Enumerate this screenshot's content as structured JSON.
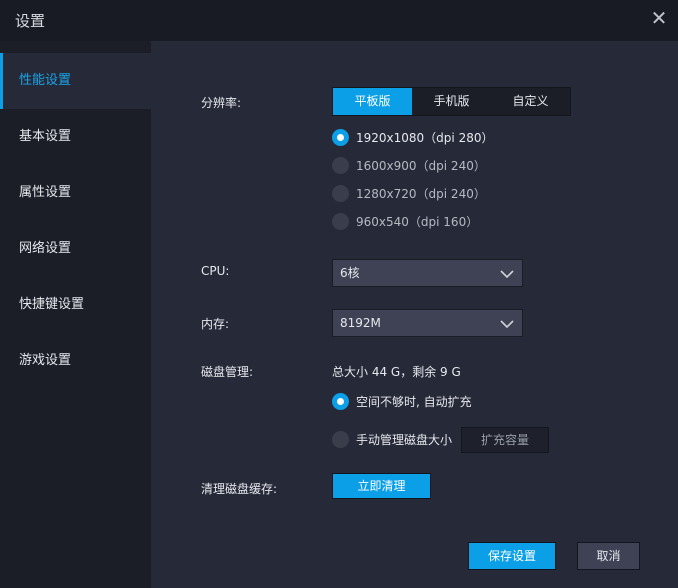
{
  "window": {
    "title": "设置"
  },
  "sidebar": {
    "items": [
      {
        "label": "性能设置",
        "active": true
      },
      {
        "label": "基本设置"
      },
      {
        "label": "属性设置"
      },
      {
        "label": "网络设置"
      },
      {
        "label": "快捷键设置"
      },
      {
        "label": "游戏设置"
      }
    ]
  },
  "resolution": {
    "label": "分辨率:",
    "tabs": [
      "平板版",
      "手机版",
      "自定义"
    ],
    "selected_tab": "平板版",
    "options": [
      "1920x1080（dpi 280）",
      "1600x900（dpi 240）",
      "1280x720（dpi 240）",
      "960x540（dpi 160）"
    ],
    "selected": "1920x1080（dpi 280）"
  },
  "cpu": {
    "label": "CPU:",
    "value": "6核"
  },
  "memory": {
    "label": "内存:",
    "value": "8192M"
  },
  "disk": {
    "label": "磁盘管理:",
    "summary": "总大小 44 G，剩余 9 G",
    "options": [
      "空间不够时, 自动扩充",
      "手动管理磁盘大小"
    ],
    "selected": "空间不够时, 自动扩充",
    "expand_label": "扩充容量"
  },
  "cache": {
    "label": "清理磁盘缓存:",
    "clear_label": "立即清理"
  },
  "footer": {
    "save_label": "保存设置",
    "cancel_label": "取消"
  },
  "colors": {
    "accent": "#0a9fe6",
    "background": "#262a38",
    "sidebar": "#1b1e27"
  }
}
